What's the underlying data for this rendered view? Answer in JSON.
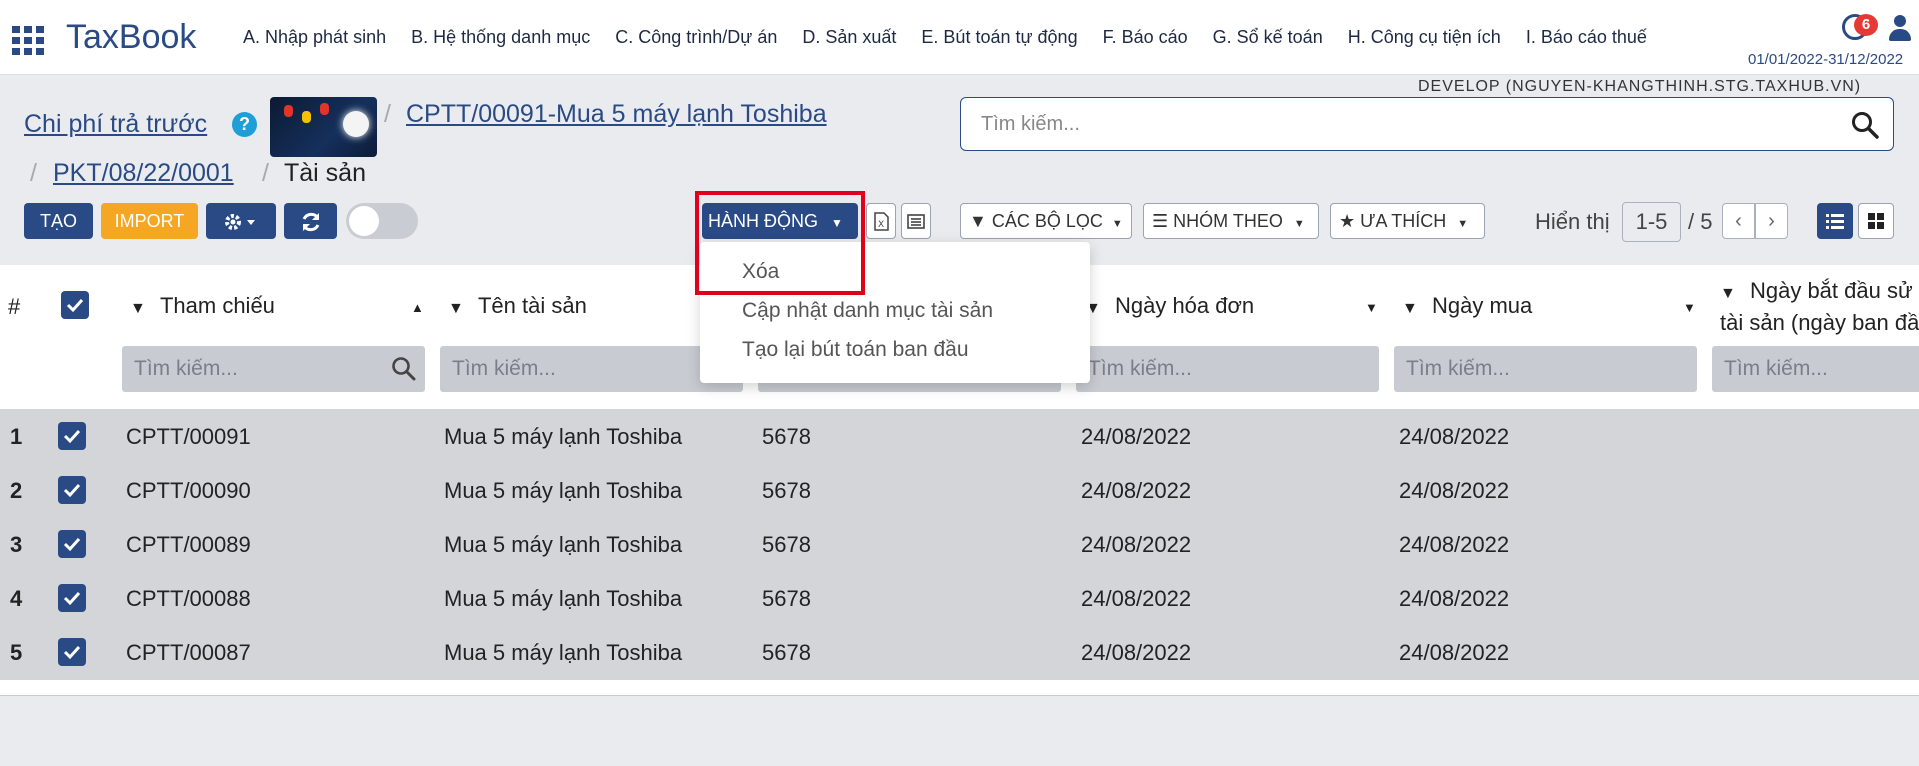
{
  "app": {
    "brand": "TaxBook",
    "period": "01/01/2022-31/12/2022",
    "notification_count": "6",
    "environment": "DEVELOP (NGUYEN-KHANGTHINH.STG.TAXHUB.VN)"
  },
  "menu": [
    "A. Nhập phát sinh",
    "B. Hệ thống danh mục",
    "C. Công trình/Dự án",
    "D. Sản xuất",
    "E. Bút toán tự động",
    "F. Báo cáo",
    "G. Sổ kế toán",
    "H. Công cụ tiện ích",
    "I. Báo cáo thuế"
  ],
  "breadcrumb": {
    "root": "Chi phí trả trước",
    "record": "CPTT/00091-Mua 5 máy lạnh Toshiba",
    "voucher": "PKT/08/22/0001",
    "current": "Tài sản"
  },
  "search": {
    "placeholder": "Tìm kiếm..."
  },
  "toolbar": {
    "create": "TẠO",
    "import": "IMPORT",
    "action": "HÀNH ĐỘNG",
    "filters": "CÁC BỘ LỌC",
    "group_by": "NHÓM THEO",
    "favorites": "ƯA THÍCH"
  },
  "pager": {
    "label": "Hiển thị",
    "value": "1-5",
    "total": "/ 5"
  },
  "action_menu": [
    "Xóa",
    "Cập nhật danh mục tài sản",
    "Tạo lại bút toán ban đầu"
  ],
  "table": {
    "hash": "#",
    "columns": [
      "Tham chiếu",
      "Tên tài sản",
      "Ngày hóa đơn",
      "Ngày mua",
      "Ngày bắt đầu sử",
      "tài sản (ngày ban đầ"
    ],
    "search_placeholder": "Tìm kiếm...",
    "rows": [
      {
        "n": "1",
        "ref": "CPTT/00091",
        "name": "Mua 5 máy lạnh Toshiba",
        "code": "5678",
        "invoice_date": "24/08/2022",
        "buy_date": "24/08/2022"
      },
      {
        "n": "2",
        "ref": "CPTT/00090",
        "name": "Mua 5 máy lạnh Toshiba",
        "code": "5678",
        "invoice_date": "24/08/2022",
        "buy_date": "24/08/2022"
      },
      {
        "n": "3",
        "ref": "CPTT/00089",
        "name": "Mua 5 máy lạnh Toshiba",
        "code": "5678",
        "invoice_date": "24/08/2022",
        "buy_date": "24/08/2022"
      },
      {
        "n": "4",
        "ref": "CPTT/00088",
        "name": "Mua 5 máy lạnh Toshiba",
        "code": "5678",
        "invoice_date": "24/08/2022",
        "buy_date": "24/08/2022"
      },
      {
        "n": "5",
        "ref": "CPTT/00087",
        "name": "Mua 5 máy lạnh Toshiba",
        "code": "5678",
        "invoice_date": "24/08/2022",
        "buy_date": "24/08/2022"
      }
    ]
  },
  "colors": {
    "primary": "#2a4a86",
    "warning": "#f5a623",
    "highlight": "#e0001b"
  }
}
